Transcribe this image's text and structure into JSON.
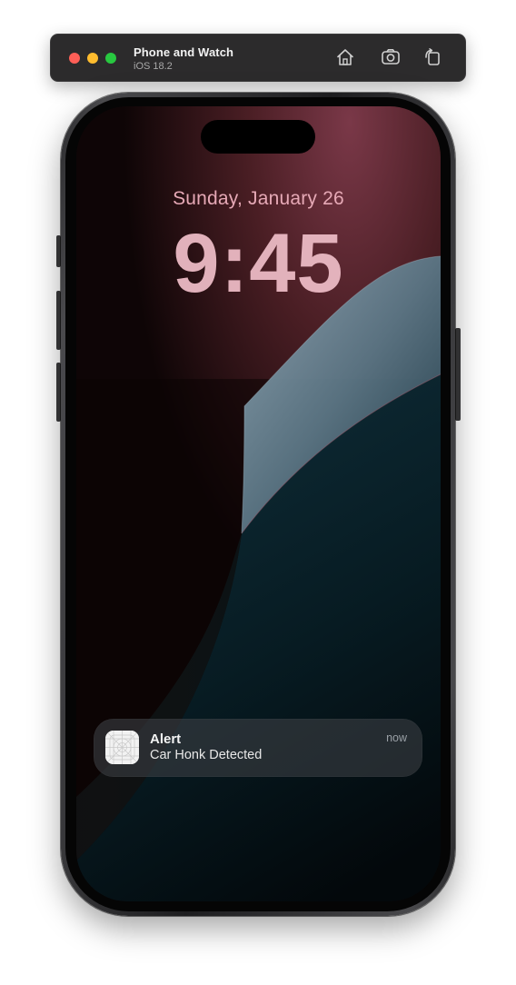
{
  "window": {
    "title": "Phone and Watch",
    "subtitle": "iOS 18.2",
    "traffic_lights": {
      "close": "#fe5f57",
      "minimize": "#febc2e",
      "zoom": "#28c840"
    },
    "toolbar": {
      "home_icon": "house-icon",
      "screenshot_icon": "camera-icon",
      "rotate_icon": "rotate-icon"
    }
  },
  "lockscreen": {
    "date": "Sunday, January 26",
    "time": "9:45"
  },
  "notification": {
    "app_icon": "app-placeholder-icon",
    "title": "Alert",
    "body": "Car Honk Detected",
    "timestamp": "now"
  },
  "colors": {
    "titlebar_bg": "#2c2b2c",
    "date_text": "#e6a9b6",
    "clock_text": "#e9b8c2"
  }
}
